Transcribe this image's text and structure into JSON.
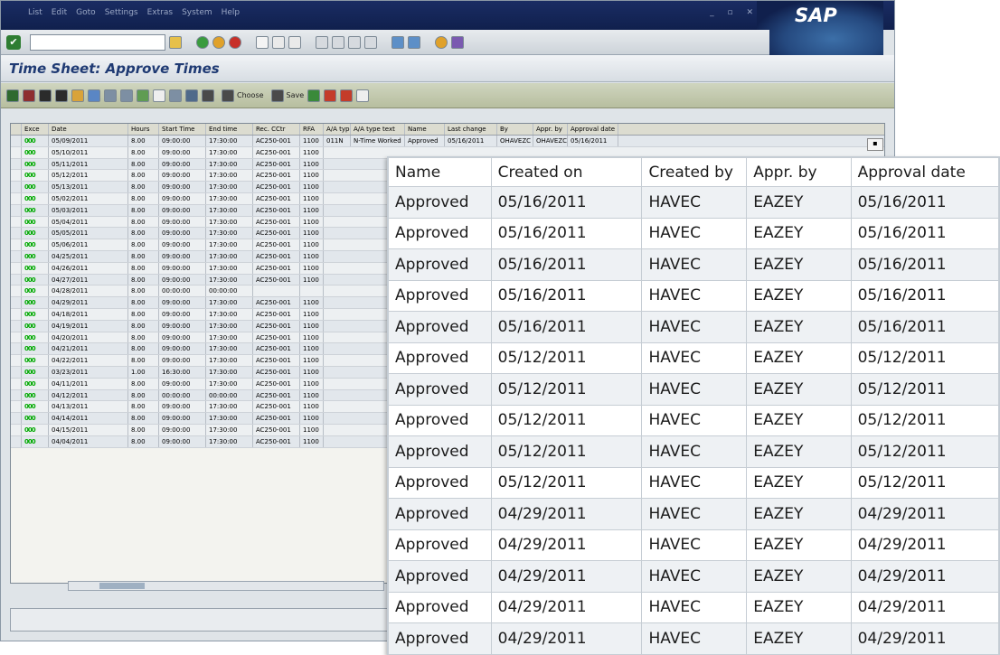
{
  "window": {
    "menu": [
      "List",
      "Edit",
      "Goto",
      "Settings",
      "Extras",
      "System",
      "Help"
    ],
    "logo": "SAP",
    "title": "Time Sheet: Approve Times",
    "toolbar_buttons": {
      "choose": "Choose",
      "save": "Save"
    }
  },
  "colors": {
    "title_text": "#1f3a73",
    "traffic_light": "#00aa00",
    "app_toolbar": "#c3c9ad"
  },
  "background_grid": {
    "columns": [
      "Exce",
      "Date",
      "Hours",
      "Start Time",
      "End time",
      "Rec. CCtr",
      "RFA",
      "A/A type",
      "A/A type text",
      "Name",
      "Last change",
      "By",
      "Appr. by",
      "Approval date"
    ],
    "first_row": [
      "000",
      "05/09/2011",
      "8.00",
      "09:00:00",
      "17:30:00",
      "AC250-001",
      "1100",
      "011N",
      "N-Time Worked",
      "Approved",
      "05/16/2011",
      "OHAVEZC",
      "OHAVEZC",
      "05/16/2011"
    ],
    "rows": [
      [
        "000",
        "05/10/2011",
        "8.00",
        "09:00:00",
        "17:30:00",
        "AC250-001",
        "1100"
      ],
      [
        "000",
        "05/11/2011",
        "8.00",
        "09:00:00",
        "17:30:00",
        "AC250-001",
        "1100"
      ],
      [
        "000",
        "05/12/2011",
        "8.00",
        "09:00:00",
        "17:30:00",
        "AC250-001",
        "1100"
      ],
      [
        "000",
        "05/13/2011",
        "8.00",
        "09:00:00",
        "17:30:00",
        "AC250-001",
        "1100"
      ],
      [
        "000",
        "05/02/2011",
        "8.00",
        "09:00:00",
        "17:30:00",
        "AC250-001",
        "1100"
      ],
      [
        "000",
        "05/03/2011",
        "8.00",
        "09:00:00",
        "17:30:00",
        "AC250-001",
        "1100"
      ],
      [
        "000",
        "05/04/2011",
        "8.00",
        "09:00:00",
        "17:30:00",
        "AC250-001",
        "1100"
      ],
      [
        "000",
        "05/05/2011",
        "8.00",
        "09:00:00",
        "17:30:00",
        "AC250-001",
        "1100"
      ],
      [
        "000",
        "05/06/2011",
        "8.00",
        "09:00:00",
        "17:30:00",
        "AC250-001",
        "1100"
      ],
      [
        "000",
        "04/25/2011",
        "8.00",
        "09:00:00",
        "17:30:00",
        "AC250-001",
        "1100"
      ],
      [
        "000",
        "04/26/2011",
        "8.00",
        "09:00:00",
        "17:30:00",
        "AC250-001",
        "1100"
      ],
      [
        "000",
        "04/27/2011",
        "8.00",
        "09:00:00",
        "17:30:00",
        "AC250-001",
        "1100"
      ],
      [
        "000",
        "04/28/2011",
        "8.00",
        "00:00:00",
        "00:00:00",
        "",
        ""
      ],
      [
        "000",
        "04/29/2011",
        "8.00",
        "09:00:00",
        "17:30:00",
        "AC250-001",
        "1100"
      ],
      [
        "000",
        "04/18/2011",
        "8.00",
        "09:00:00",
        "17:30:00",
        "AC250-001",
        "1100"
      ],
      [
        "000",
        "04/19/2011",
        "8.00",
        "09:00:00",
        "17:30:00",
        "AC250-001",
        "1100"
      ],
      [
        "000",
        "04/20/2011",
        "8.00",
        "09:00:00",
        "17:30:00",
        "AC250-001",
        "1100"
      ],
      [
        "000",
        "04/21/2011",
        "8.00",
        "09:00:00",
        "17:30:00",
        "AC250-001",
        "1100"
      ],
      [
        "000",
        "04/22/2011",
        "8.00",
        "09:00:00",
        "17:30:00",
        "AC250-001",
        "1100"
      ],
      [
        "000",
        "03/23/2011",
        "1.00",
        "16:30:00",
        "17:30:00",
        "AC250-001",
        "1100"
      ],
      [
        "000",
        "04/11/2011",
        "8.00",
        "09:00:00",
        "17:30:00",
        "AC250-001",
        "1100"
      ],
      [
        "000",
        "04/12/2011",
        "8.00",
        "00:00:00",
        "00:00:00",
        "AC250-001",
        "1100"
      ],
      [
        "000",
        "04/13/2011",
        "8.00",
        "09:00:00",
        "17:30:00",
        "AC250-001",
        "1100"
      ],
      [
        "000",
        "04/14/2011",
        "8.00",
        "09:00:00",
        "17:30:00",
        "AC250-001",
        "1100"
      ],
      [
        "000",
        "04/15/2011",
        "8.00",
        "09:00:00",
        "17:30:00",
        "AC250-001",
        "1100"
      ],
      [
        "000",
        "04/04/2011",
        "8.00",
        "09:00:00",
        "17:30:00",
        "AC250-001",
        "1100"
      ]
    ]
  },
  "zoom_table": {
    "headers": [
      "Name",
      "Created on",
      "Created by",
      "Appr. by",
      "Approval date"
    ],
    "rows": [
      [
        "Approved",
        "05/16/2011",
        "HAVEC",
        "EAZEY",
        "05/16/2011"
      ],
      [
        "Approved",
        "05/16/2011",
        "HAVEC",
        "EAZEY",
        "05/16/2011"
      ],
      [
        "Approved",
        "05/16/2011",
        "HAVEC",
        "EAZEY",
        "05/16/2011"
      ],
      [
        "Approved",
        "05/16/2011",
        "HAVEC",
        "EAZEY",
        "05/16/2011"
      ],
      [
        "Approved",
        "05/16/2011",
        "HAVEC",
        "EAZEY",
        "05/16/2011"
      ],
      [
        "Approved",
        "05/12/2011",
        "HAVEC",
        "EAZEY",
        "05/12/2011"
      ],
      [
        "Approved",
        "05/12/2011",
        "HAVEC",
        "EAZEY",
        "05/12/2011"
      ],
      [
        "Approved",
        "05/12/2011",
        "HAVEC",
        "EAZEY",
        "05/12/2011"
      ],
      [
        "Approved",
        "05/12/2011",
        "HAVEC",
        "EAZEY",
        "05/12/2011"
      ],
      [
        "Approved",
        "05/12/2011",
        "HAVEC",
        "EAZEY",
        "05/12/2011"
      ],
      [
        "Approved",
        "04/29/2011",
        "HAVEC",
        "EAZEY",
        "04/29/2011"
      ],
      [
        "Approved",
        "04/29/2011",
        "HAVEC",
        "EAZEY",
        "04/29/2011"
      ],
      [
        "Approved",
        "04/29/2011",
        "HAVEC",
        "EAZEY",
        "04/29/2011"
      ],
      [
        "Approved",
        "04/29/2011",
        "HAVEC",
        "EAZEY",
        "04/29/2011"
      ],
      [
        "Approved",
        "04/29/2011",
        "HAVEC",
        "EAZEY",
        "04/29/2011"
      ]
    ]
  }
}
